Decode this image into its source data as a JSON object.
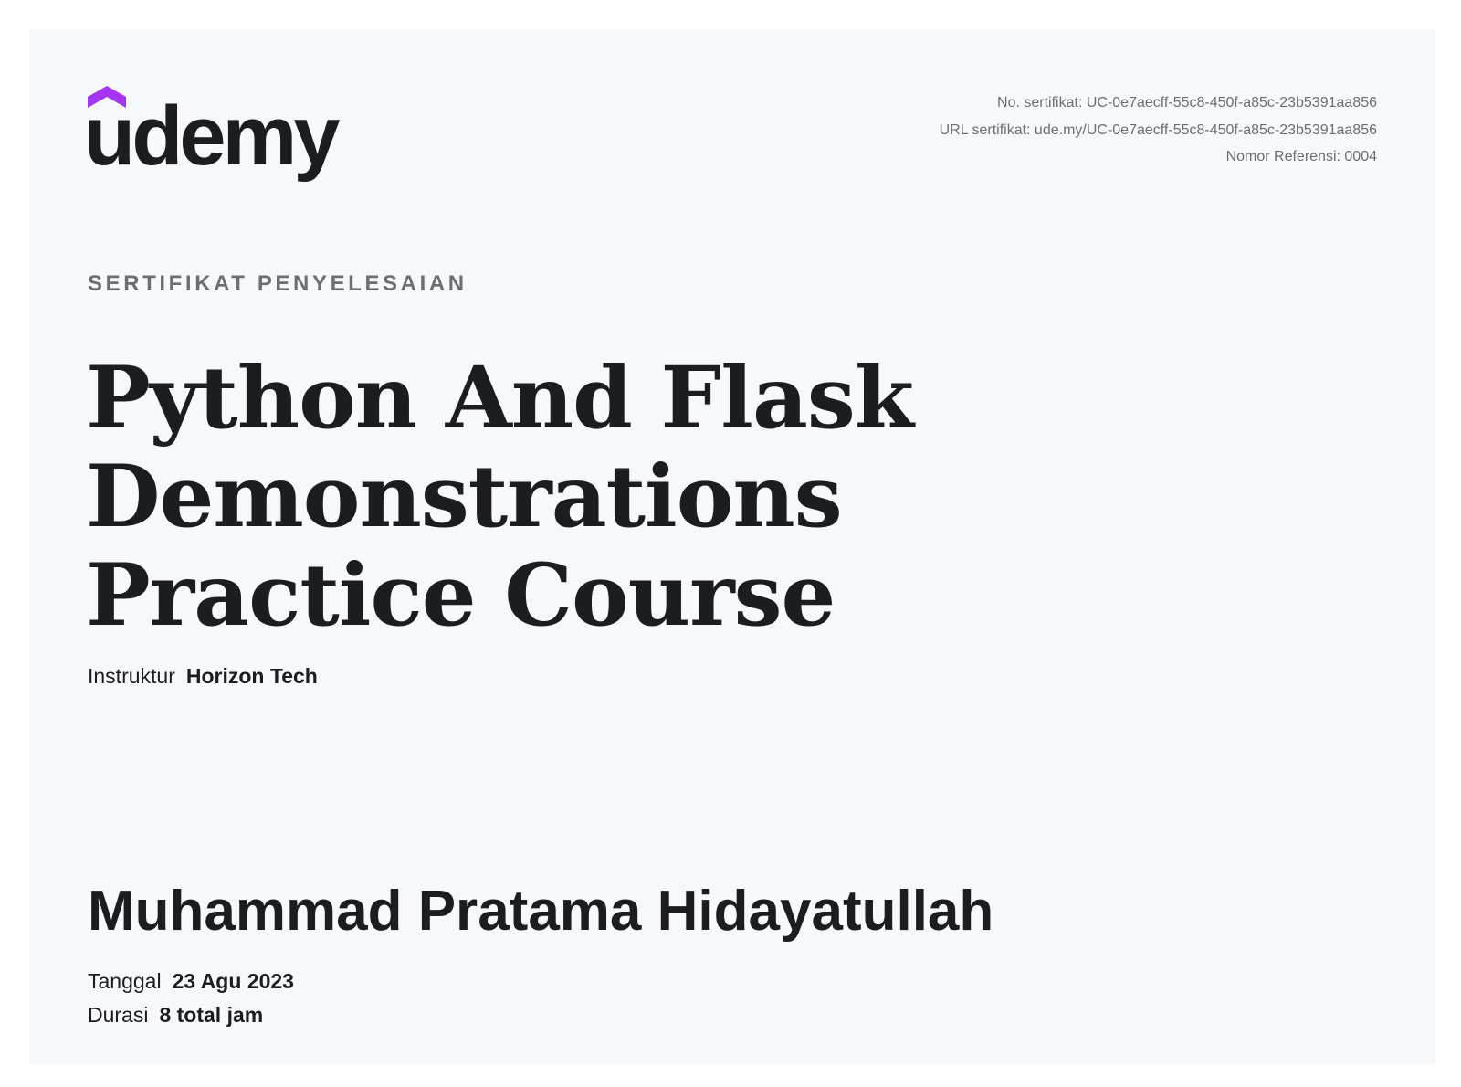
{
  "brand": {
    "name": "udemy",
    "accent_color": "#a435f0",
    "text_color": "#1c1d1f"
  },
  "meta": {
    "certificate_no": "No. sertifikat: UC-0e7aecff-55c8-450f-a85c-23b5391aa856",
    "certificate_url": "URL sertifikat: ude.my/UC-0e7aecff-55c8-450f-a85c-23b5391aa856",
    "reference_no": "Nomor Referensi: 0004"
  },
  "certificate": {
    "eyebrow": "SERTIFIKAT PENYELESAIAN",
    "course_title": "Python And Flask Demonstrations Practice Course",
    "instructor_label": "Instruktur",
    "instructor_name": "Horizon Tech",
    "recipient_name": "Muhammad Pratama Hidayatullah",
    "date_label": "Tanggal",
    "date_value": "23 Agu 2023",
    "duration_label": "Durasi",
    "duration_value": "8 total jam"
  },
  "colors": {
    "page_background": "#ffffff",
    "card_background": "#f7f8fa",
    "muted_text": "#6a6f73"
  }
}
